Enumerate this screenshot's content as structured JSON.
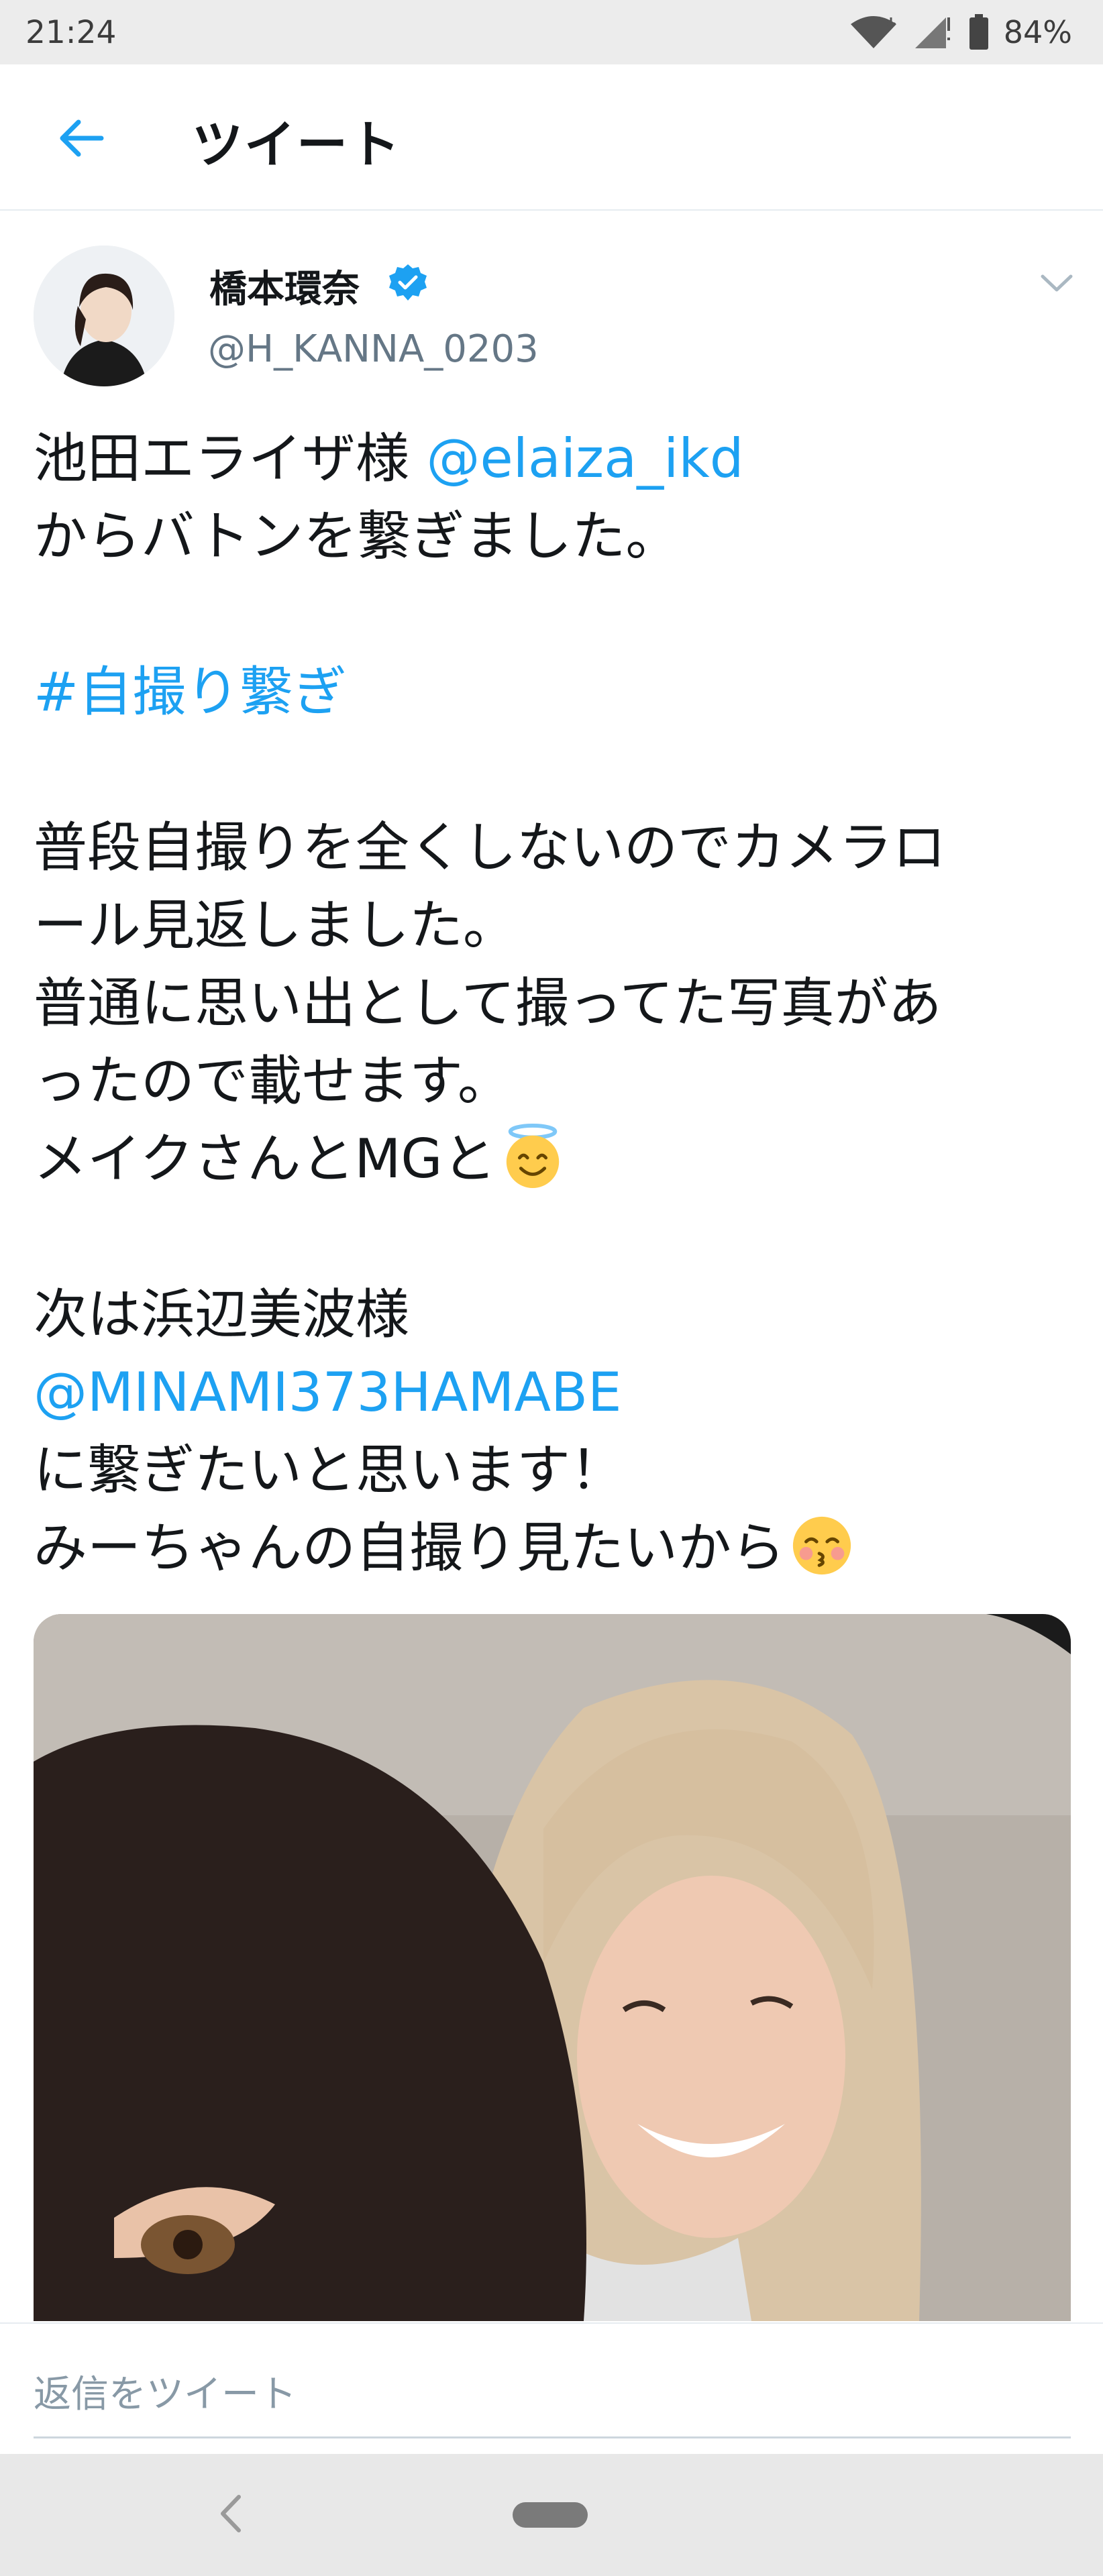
{
  "status_bar": {
    "time": "21:24",
    "battery": "84%",
    "icons": [
      "wifi-icon",
      "signal-icon",
      "battery-icon"
    ]
  },
  "header": {
    "back_icon": "arrow-left-icon",
    "title": "ツイート"
  },
  "tweet": {
    "author_name": "橋本環奈",
    "verified": true,
    "handle": "@H_KANNA_0203",
    "lines": {
      "l1_text": "池田エライザ様 ",
      "l1_link": "@elaiza_ikd",
      "l2": "からバトンを繋ぎました。",
      "l4_hashtag": "#自撮り繋ぎ",
      "l6": "普段自撮りを全くしないのでカメラロ",
      "l7": "ール見返しました。",
      "l8": "普通に思い出として撮ってた写真があ",
      "l9": "ったので載せます。",
      "l10": "メイクさんとMGと",
      "l12": "次は浜辺美波様",
      "l13_link": "@MINAMI373HAMABE",
      "l14": "に繋ぎたいと思います！",
      "l15": "みーちゃんの自撮り見たいから"
    },
    "emojis": [
      "smiling-face-with-halo-emoji",
      "kissing-face-with-closed-eyes-emoji"
    ]
  },
  "reply": {
    "placeholder": "返信をツイート"
  },
  "colors": {
    "accent": "#1da1f2",
    "text": "#14171a",
    "secondary": "#657786"
  }
}
